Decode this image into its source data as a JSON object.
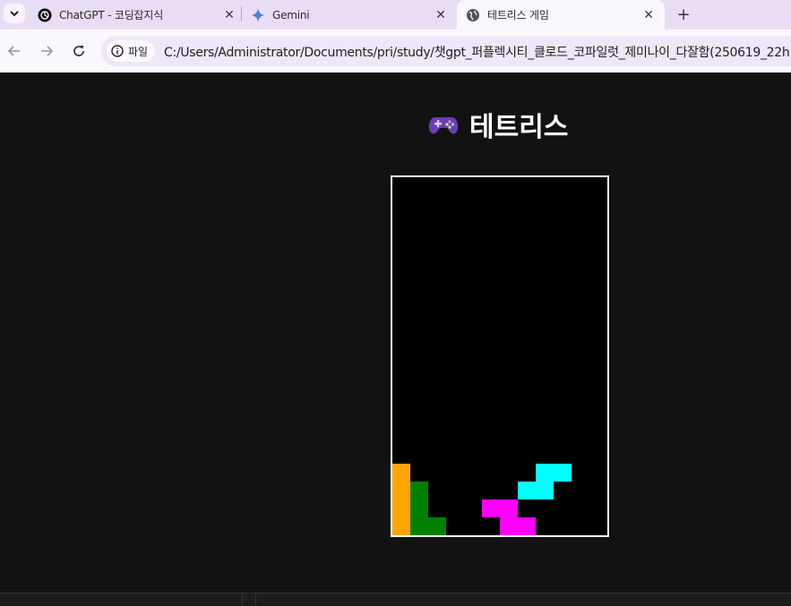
{
  "browser": {
    "tabs": [
      {
        "title": "ChatGPT - 코딩잡지식",
        "favicon": "openai-icon"
      },
      {
        "title": "Gemini",
        "favicon": "gemini-icon"
      },
      {
        "title": "테트리스 게임",
        "favicon": "globe-icon",
        "active": true
      }
    ],
    "new_tab_label": "+",
    "site_chip": "파일",
    "url": "C:/Users/Administrator/Documents/pri/study/챗gpt_퍼플렉시티_클로드_코파일럿_제미나이_다잘함(250619_22h"
  },
  "page": {
    "title": "테트리스",
    "title_icon": "game-controller-icon"
  },
  "tetris": {
    "columns": 12,
    "rows": 20,
    "colors": {
      "L": "#ffa500",
      "J": "#008000",
      "T": "#ff00ff",
      "S": "#00ffff"
    },
    "board": [
      [
        0,
        16,
        "L"
      ],
      [
        0,
        17,
        "L"
      ],
      [
        0,
        18,
        "L"
      ],
      [
        0,
        19,
        "L"
      ],
      [
        1,
        17,
        "J"
      ],
      [
        1,
        18,
        "J"
      ],
      [
        1,
        19,
        "J"
      ],
      [
        2,
        19,
        "J"
      ],
      [
        5,
        18,
        "T"
      ],
      [
        6,
        18,
        "T"
      ],
      [
        6,
        19,
        "T"
      ],
      [
        7,
        19,
        "T"
      ],
      [
        8,
        16,
        "S"
      ],
      [
        9,
        16,
        "S"
      ],
      [
        7,
        17,
        "S"
      ],
      [
        8,
        17,
        "S"
      ]
    ]
  }
}
